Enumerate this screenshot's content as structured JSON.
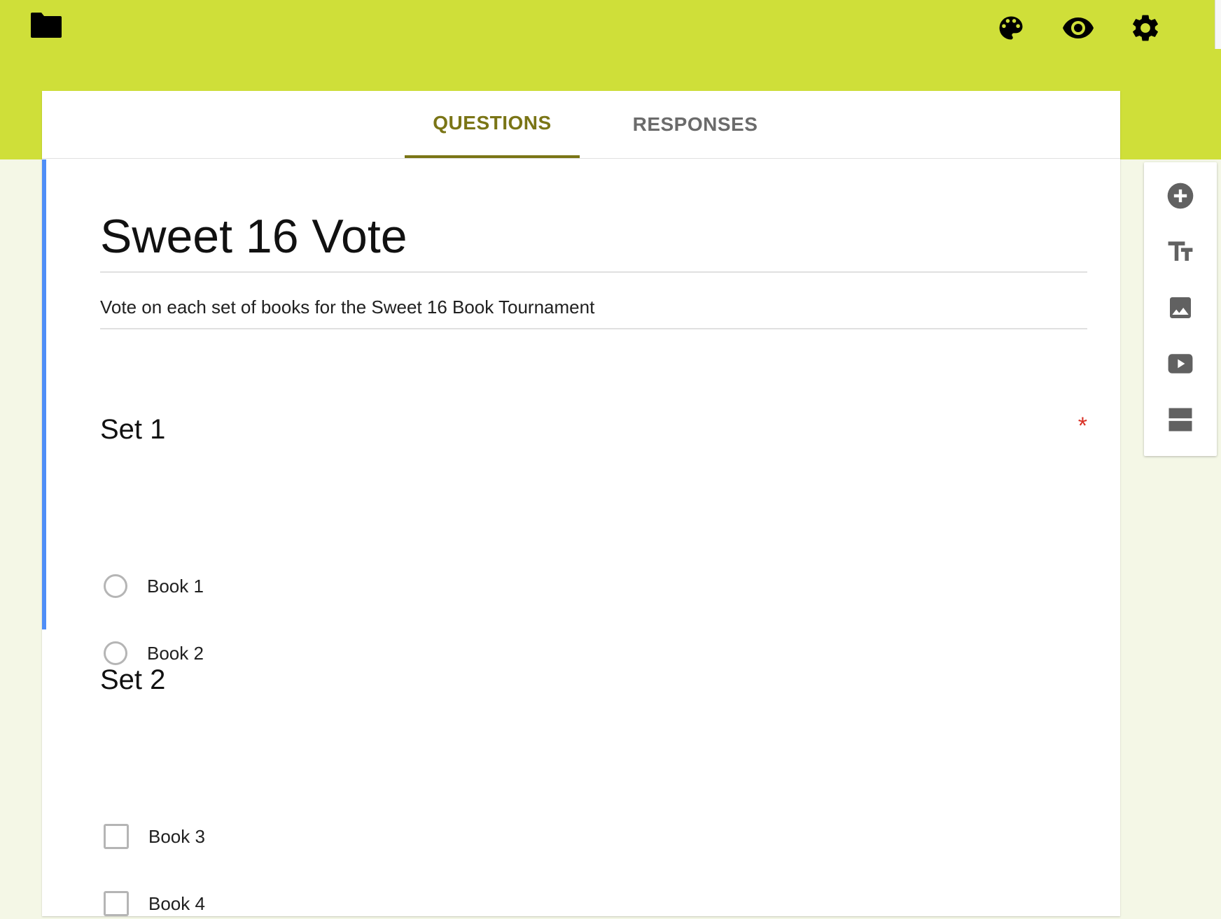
{
  "header": {
    "folder_icon": "folder-icon",
    "palette_icon": "palette-icon",
    "preview_icon": "eye-icon",
    "settings_icon": "gear-icon"
  },
  "tabs": [
    {
      "label": "QUESTIONS",
      "active": true
    },
    {
      "label": "RESPONSES",
      "active": false
    }
  ],
  "form": {
    "title": "Sweet 16 Vote",
    "description": "Vote on each set of books for the Sweet 16 Book Tournament"
  },
  "questions": [
    {
      "title": "Set 1",
      "required_mark": "*",
      "type": "radio",
      "options": [
        "Book 1",
        "Book 2"
      ]
    },
    {
      "title": "Set 2",
      "type": "checkbox",
      "options": [
        "Book 3",
        "Book 4"
      ]
    }
  ],
  "toolbar": {
    "items": [
      "add-question-icon",
      "title-text-icon",
      "image-icon",
      "video-icon",
      "section-icon"
    ]
  },
  "colors": {
    "header_bg": "#cfdf39",
    "page_bg": "#f4f7e6",
    "active_tab": "#7a7516",
    "focus_bar": "#4f8ef7",
    "required": "#d93025"
  }
}
